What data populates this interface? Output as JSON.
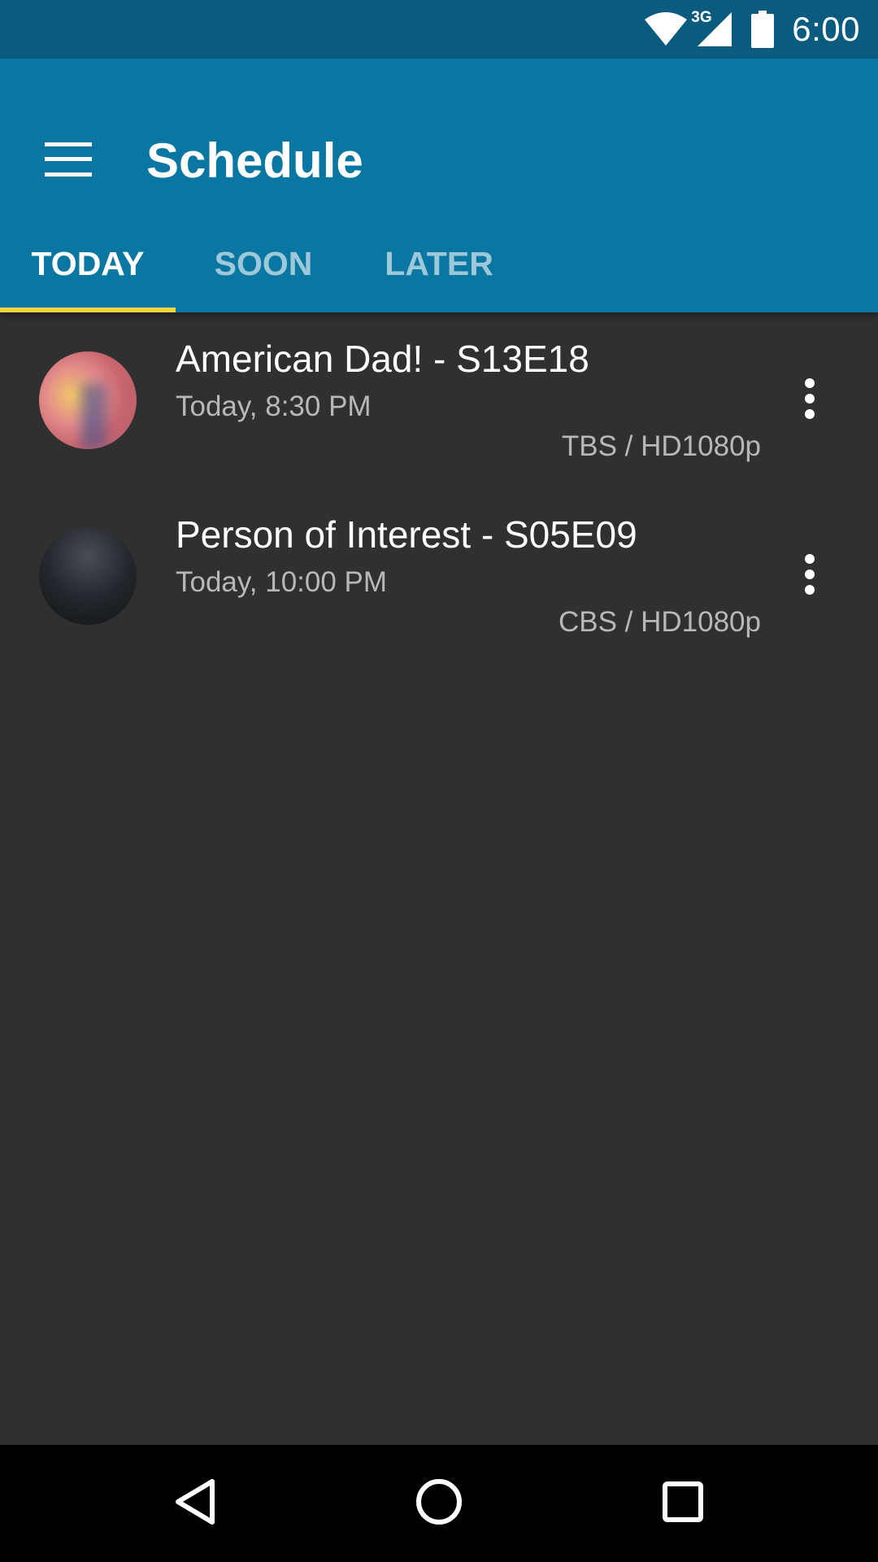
{
  "status_bar": {
    "time": "6:00",
    "network_label": "3G",
    "icons": [
      "wifi-icon",
      "cell-signal-icon",
      "battery-icon"
    ]
  },
  "app_bar": {
    "title": "Schedule",
    "menu_icon": "menu-icon",
    "background_color": "#0a77a2",
    "status_color": "#0b5b7f"
  },
  "tabs": [
    {
      "label": "TODAY",
      "active": true
    },
    {
      "label": "SOON",
      "active": false
    },
    {
      "label": "LATER",
      "active": false
    }
  ],
  "tab_indicator_color": "#f5d53f",
  "episodes": [
    {
      "title": "American Dad! - S13E18",
      "time": "Today, 8:30 PM",
      "network": "TBS / HD1080p",
      "menu_icon": "more-vert-icon"
    },
    {
      "title": "Person of Interest - S05E09",
      "time": "Today, 10:00 PM",
      "network": "CBS / HD1080p",
      "menu_icon": "more-vert-icon"
    }
  ],
  "nav_bar": {
    "icons": [
      "back-icon",
      "home-icon",
      "recents-icon"
    ]
  }
}
